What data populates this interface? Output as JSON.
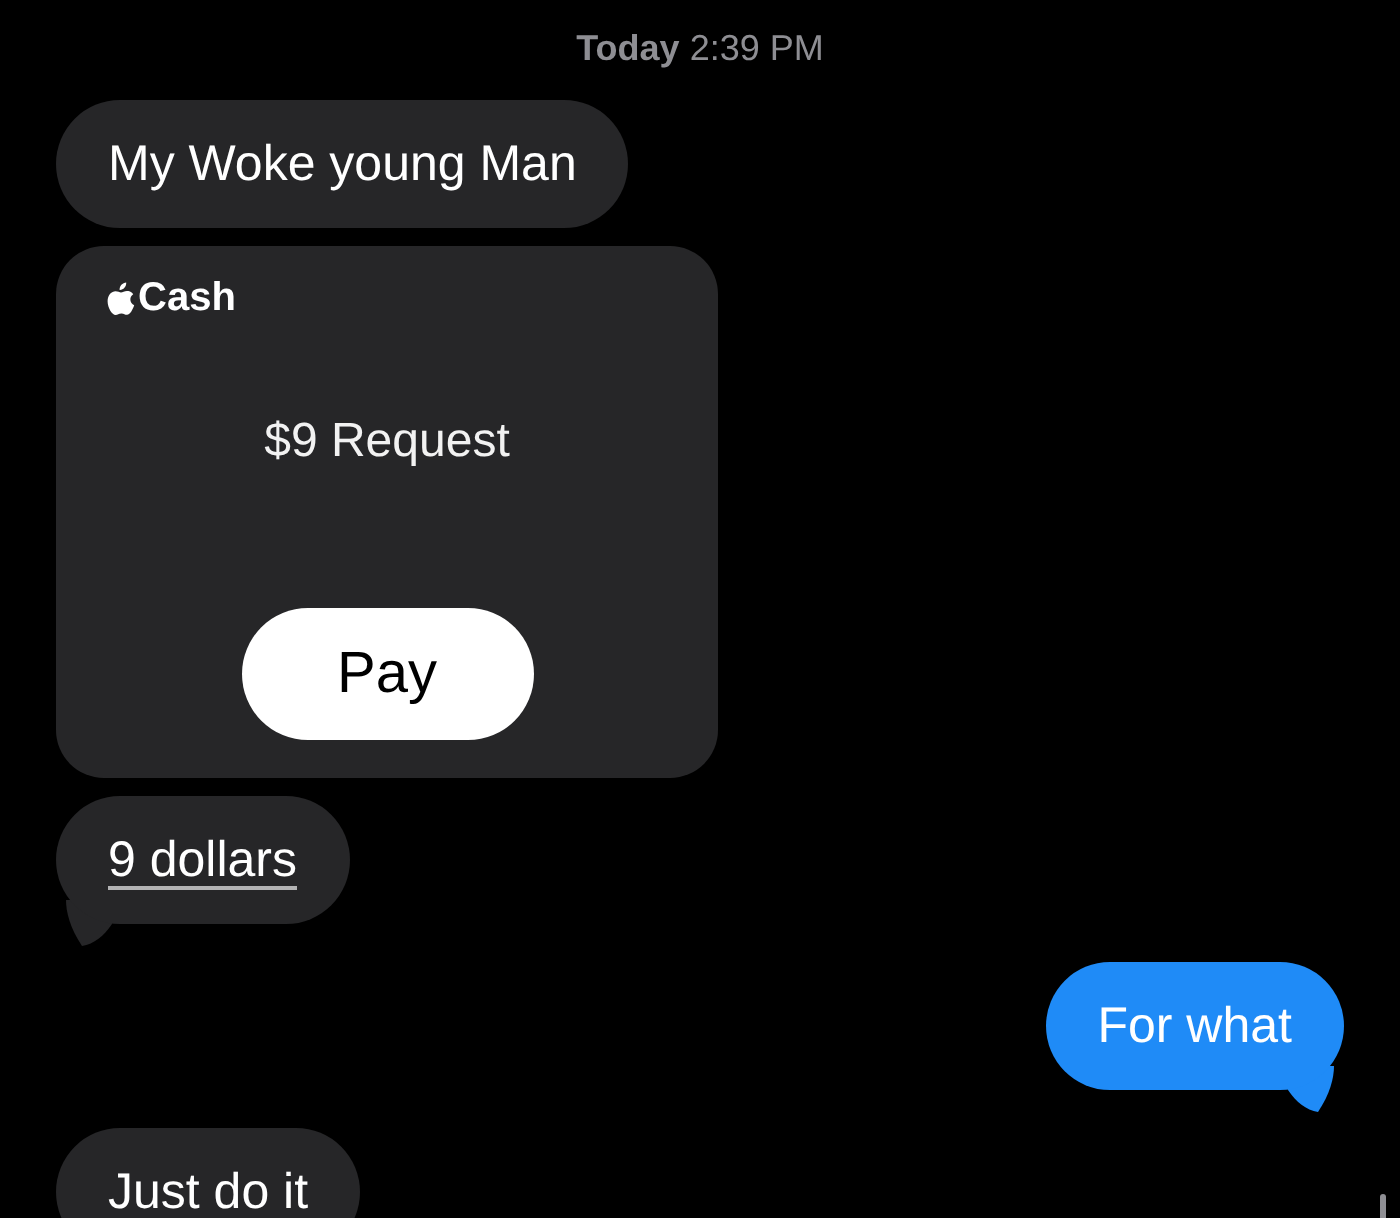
{
  "timestamp": "**Today** 2:39 PM",
  "messages": [
    {
      "kind": "text",
      "outgoing": false,
      "text": "My Woke young Man",
      "link": false,
      "tail": false
    },
    {
      "kind": "cash",
      "outgoing": false,
      "brand": "Cash",
      "amount": "$9 Request",
      "button": "Pay"
    },
    {
      "kind": "text",
      "outgoing": false,
      "text": "9 dollars",
      "link": true,
      "tail": true
    },
    {
      "kind": "text",
      "outgoing": true,
      "text": "For what",
      "link": false,
      "tail": true
    },
    {
      "kind": "text",
      "outgoing": false,
      "text": "Just do it"
    }
  ]
}
